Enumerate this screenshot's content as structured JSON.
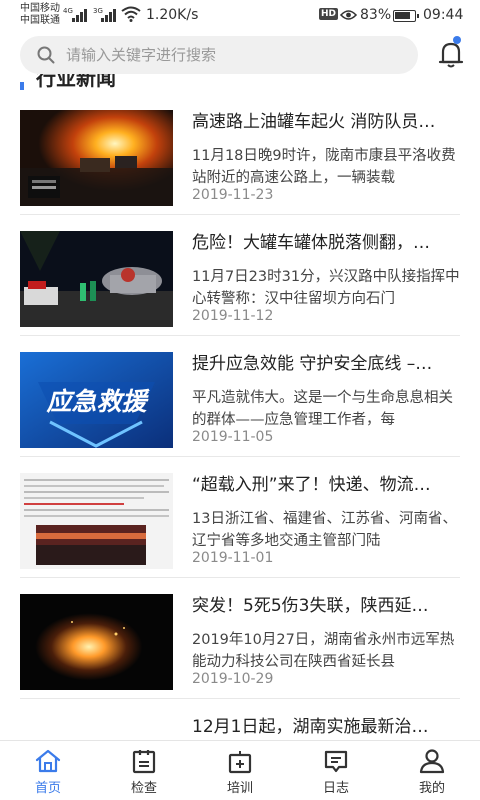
{
  "status_bar": {
    "carrier1": "中国移动",
    "carrier2": "中国联通",
    "sig1_label": "4G",
    "sig2_label": "3G",
    "net_speed": "1.20K/s",
    "hd_badge": "HD",
    "battery_pct": "83%",
    "battery_level": 0.83,
    "time": "09:44"
  },
  "search": {
    "placeholder": "请输入关键字进行搜索"
  },
  "section": {
    "title": "行业新闻"
  },
  "news": [
    {
      "headline": "高速路上油罐车起火 消防队员…",
      "summary": "11月18日晚9时许，陇南市康县平洛收费站附近的高速公路上，一辆装载",
      "date": "2019-11-23"
    },
    {
      "headline": "危险！大罐车罐体脱落侧翻，…",
      "summary": "11月7日23时31分，兴汉路中队接指挥中心转警称：汉中往留坝方向石门",
      "date": "2019-11-12"
    },
    {
      "headline": "提升应急效能 守护安全底线 –…",
      "summary": "平凡造就伟大。这是一个与生命息息相关的群体——应急管理工作者，每",
      "date": "2019-11-05",
      "thumb_text": "应急救援"
    },
    {
      "headline": "“超载入刑”来了！快递、物流…",
      "summary": "13日浙江省、福建省、江苏省、河南省、辽宁省等多地交通主管部门陆",
      "date": "2019-11-01"
    },
    {
      "headline": "突发！5死5伤3失联，陕西延…",
      "summary": "2019年10月27日，湖南省永州市远军热能动力科技公司在陕西省延长县",
      "date": "2019-10-29"
    },
    {
      "headline": "12月1日起，湖南实施最新治…",
      "summary": "",
      "date": ""
    }
  ],
  "nav": {
    "items": [
      {
        "label": "首页",
        "icon": "home-icon",
        "active": true
      },
      {
        "label": "检查",
        "icon": "inspect-icon",
        "active": false
      },
      {
        "label": "培训",
        "icon": "training-icon",
        "active": false
      },
      {
        "label": "日志",
        "icon": "log-icon",
        "active": false
      },
      {
        "label": "我的",
        "icon": "profile-icon",
        "active": false
      }
    ]
  },
  "colors": {
    "accent": "#3b7bea",
    "text": "#222222",
    "muted": "#8a8a8a"
  }
}
